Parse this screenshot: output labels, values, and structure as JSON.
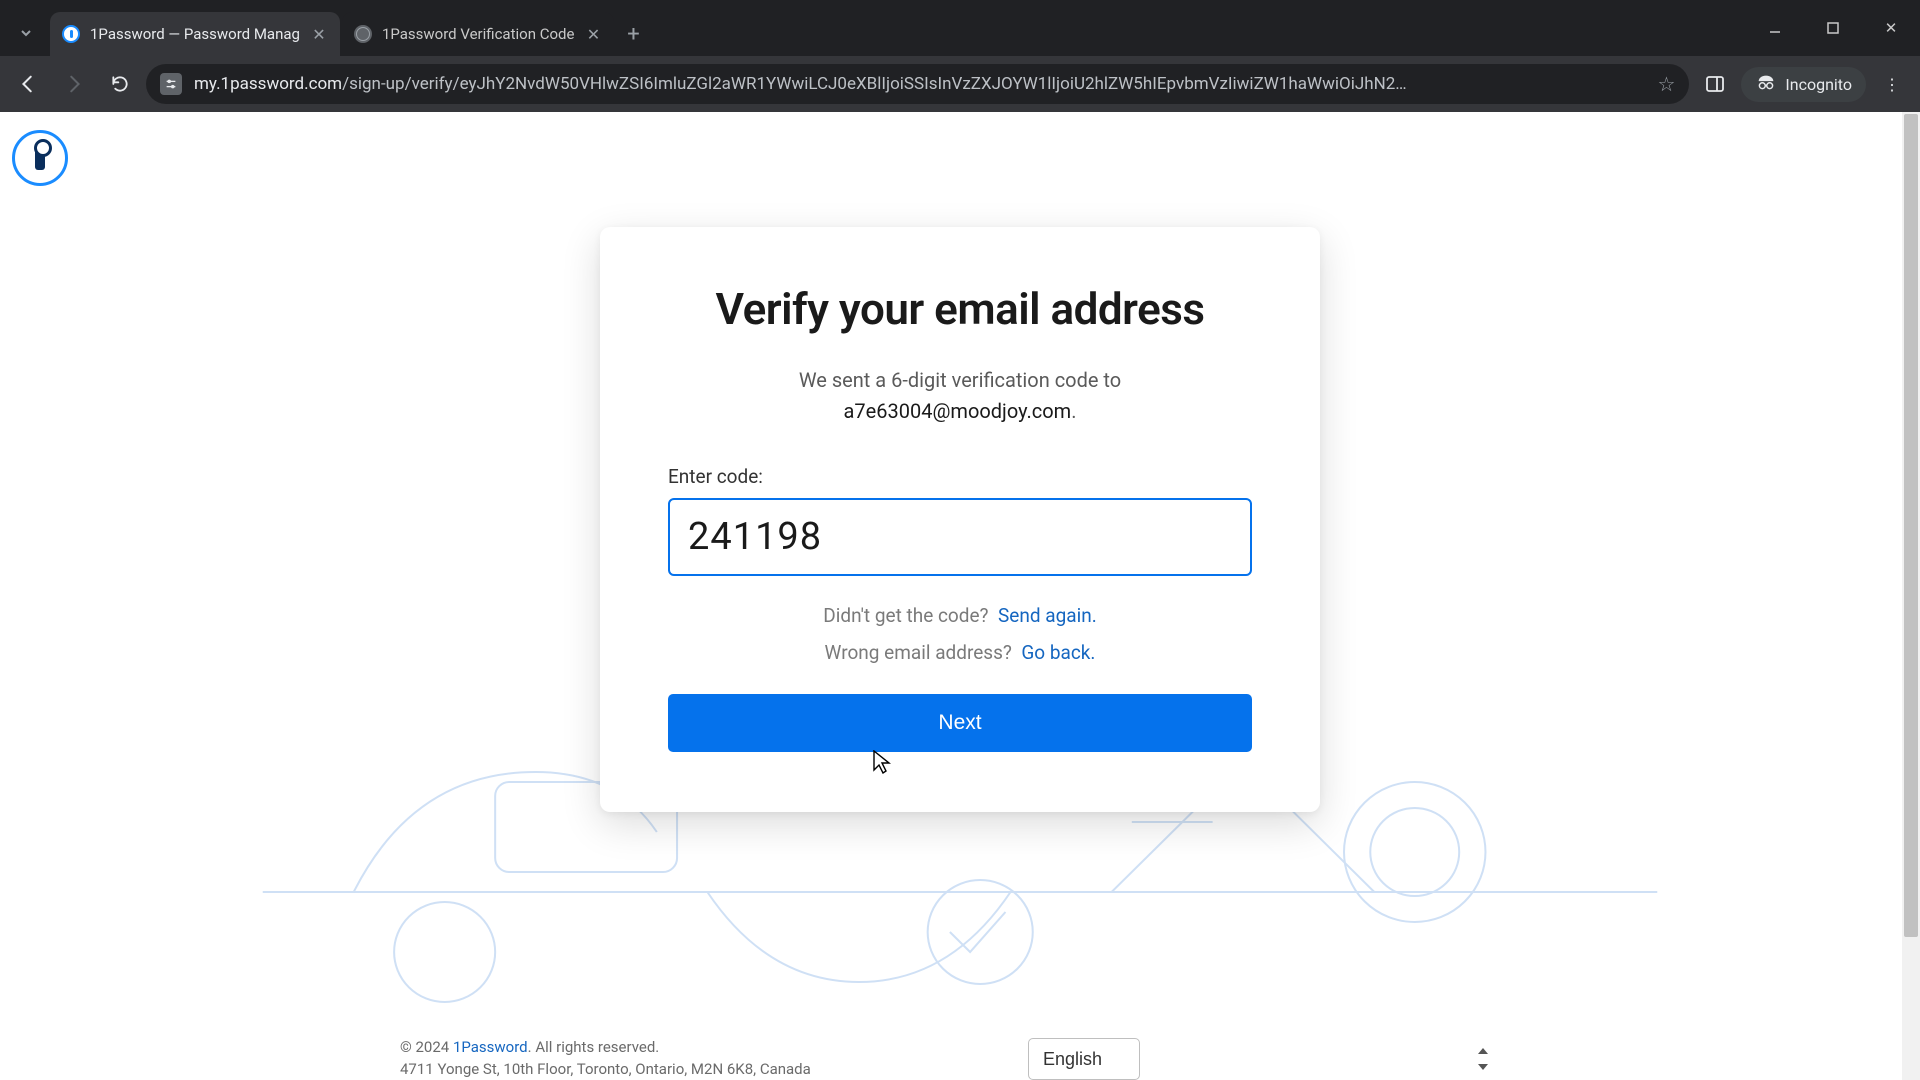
{
  "browser": {
    "tabs": [
      {
        "title": "1Password — Password Manag",
        "active": true
      },
      {
        "title": "1Password Verification Code",
        "active": false
      }
    ],
    "url_domain": "my.1password.com",
    "url_path": "/sign-up/verify/eyJhY2NvdW50VHlwZSI6ImluZGl2aWR1YWwiLCJ0eXBlIjoiSSIsInVzZXJOYW1lIjoiU2hlZW5hIEpvbmVzIiwiZW1haWwiOiJhN2…",
    "incognito_label": "Incognito"
  },
  "card": {
    "heading": "Verify your email address",
    "subtitle_prefix": "We sent a 6-digit verification code to",
    "email": "a7e63004@moodjoy.com",
    "field_label": "Enter code:",
    "code_value": "241198",
    "resend_prompt": "Didn't get the code?",
    "resend_link": "Send again.",
    "wrong_prompt": "Wrong email address?",
    "wrong_link": "Go back.",
    "next_label": "Next"
  },
  "footer": {
    "copyright_prefix": "© 2024 ",
    "brand": "1Password",
    "copyright_suffix": ". All rights reserved.",
    "address": "4711 Yonge St, 10th Floor, Toronto, Ontario, M2N 6K8, Canada",
    "language": "English"
  }
}
